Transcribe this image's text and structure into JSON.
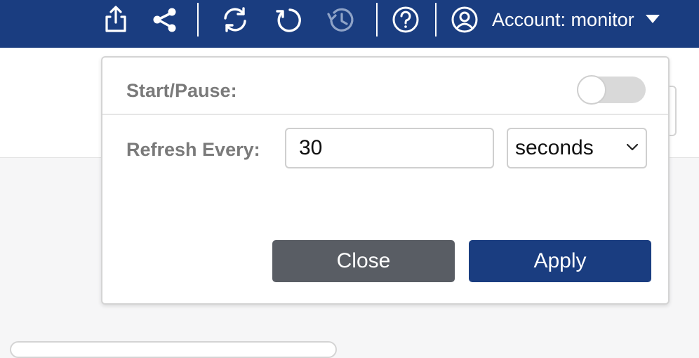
{
  "toolbar": {
    "icons": [
      "share-export-icon",
      "share-icon",
      "refresh-icon",
      "reload-icon",
      "history-icon",
      "help-icon"
    ],
    "account_label": "Account: monitor"
  },
  "auto_refresh": {
    "start_pause_label": "Start/Pause:",
    "enabled": false,
    "refresh_label": "Refresh Every:",
    "interval_value": "30",
    "unit_selected": "seconds",
    "close_label": "Close",
    "apply_label": "Apply"
  },
  "colors": {
    "topbar": "#1a3d80",
    "apply": "#1a3d80",
    "close": "#595d64",
    "icon_disabled": "#8fa3c7"
  }
}
